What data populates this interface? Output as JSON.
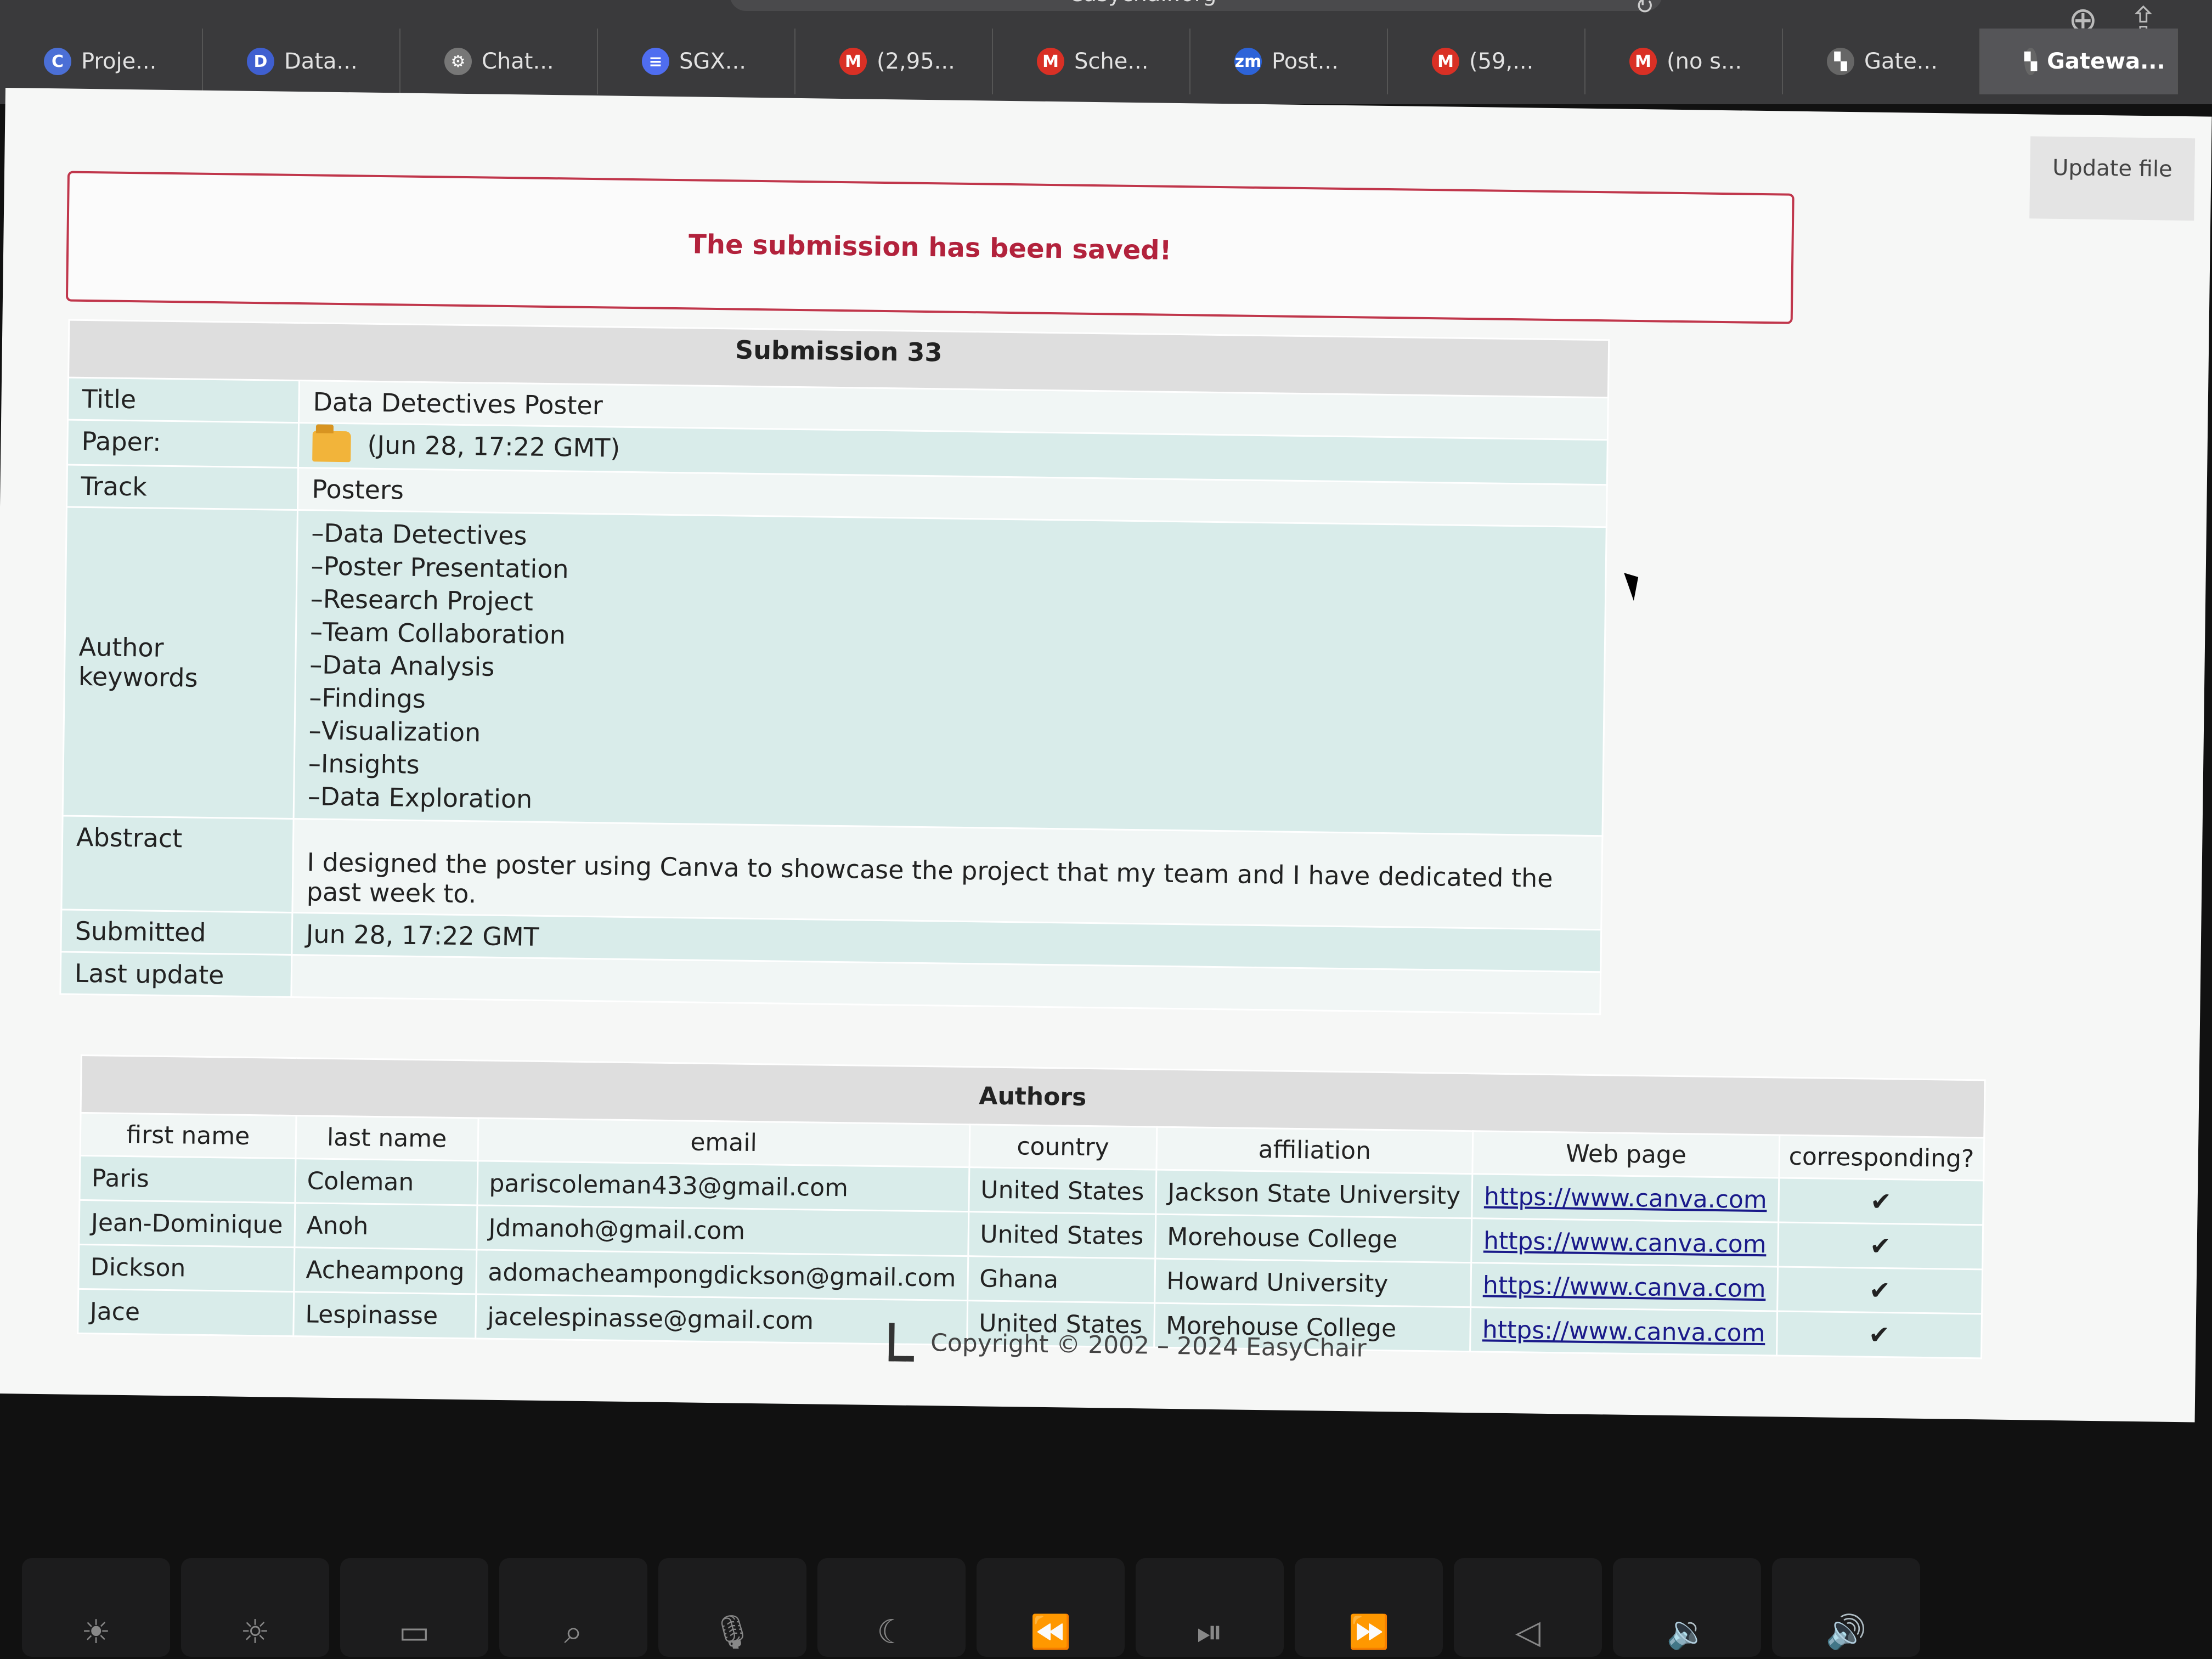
{
  "browser": {
    "url": "easychair.org",
    "tabs": [
      {
        "label": "Proje...",
        "icon": "copilot-icon",
        "color": "#4b6fd6",
        "glyph": "C"
      },
      {
        "label": "Data...",
        "icon": "data-icon",
        "color": "#3f5fd0",
        "glyph": "D"
      },
      {
        "label": "Chat...",
        "icon": "openai-icon",
        "color": "#777777",
        "glyph": "⚙"
      },
      {
        "label": "SGX...",
        "icon": "docs-icon",
        "color": "#4f6df0",
        "glyph": "≡"
      },
      {
        "label": "(2,95...",
        "icon": "gmail-icon",
        "color": "#d93025",
        "glyph": "M"
      },
      {
        "label": "Sche...",
        "icon": "gmail-icon",
        "color": "#d93025",
        "glyph": "M"
      },
      {
        "label": "Post...",
        "icon": "zoom-icon",
        "color": "#2d63d8",
        "glyph": "zm"
      },
      {
        "label": "(59,...",
        "icon": "gmail-icon",
        "color": "#d93025",
        "glyph": "M"
      },
      {
        "label": "(no s...",
        "icon": "gmail-icon",
        "color": "#d93025",
        "glyph": "M"
      },
      {
        "label": "Gate...",
        "icon": "easychair-icon",
        "color": "#666666",
        "glyph": "▚"
      },
      {
        "label": "Gatewa...",
        "icon": "easychair-icon",
        "color": "#666666",
        "glyph": "▚"
      }
    ]
  },
  "page": {
    "update_file": "Update file",
    "banner": "The submission has been saved!",
    "submission": {
      "caption": "Submission 33",
      "rows": {
        "title_label": "Title",
        "title_value": "Data Detectives Poster",
        "paper_label": "Paper:",
        "paper_value": "(Jun 28, 17:22 GMT)",
        "track_label": "Track",
        "track_value": "Posters",
        "keywords_label": "Author keywords",
        "keywords": [
          "–Data Detectives",
          "–Poster Presentation",
          "–Research Project",
          "–Team Collaboration",
          "–Data Analysis",
          "–Findings",
          "–Visualization",
          "–Insights",
          "–Data Exploration"
        ],
        "abstract_label": "Abstract",
        "abstract_value": "I designed the poster using Canva to showcase the project that my team and I have dedicated the past week to.",
        "submitted_label": "Submitted",
        "submitted_value": "Jun 28, 17:22 GMT",
        "last_update_label": "Last update",
        "last_update_value": ""
      }
    },
    "authors": {
      "caption": "Authors",
      "headers": [
        "first name",
        "last name",
        "email",
        "country",
        "affiliation",
        "Web page",
        "corresponding?"
      ],
      "rows": [
        [
          "Paris",
          "Coleman",
          "pariscoleman433@gmail.com",
          "United States",
          "Jackson State University",
          "https://www.canva.com",
          "✔"
        ],
        [
          "Jean-Dominique",
          "Anoh",
          "Jdmanoh@gmail.com",
          "United States",
          "Morehouse College",
          "https://www.canva.com",
          "✔"
        ],
        [
          "Dickson",
          "Acheampong",
          "adomacheampongdickson@gmail.com",
          "Ghana",
          "Howard University",
          "https://www.canva.com",
          "✔"
        ],
        [
          "Jace",
          "Lespinasse",
          "jacelespinasse@gmail.com",
          "United States",
          "Morehouse College",
          "https://www.canva.com",
          "✔"
        ]
      ]
    },
    "footer": "Copyright © 2002 – 2024 EasyChair"
  },
  "keyboard": {
    "keys": [
      "☀",
      "☼",
      "▭",
      "⌕",
      "🎙",
      "☾",
      "⏪",
      "⏯",
      "⏩",
      "◁",
      "🔉",
      "🔊"
    ]
  }
}
